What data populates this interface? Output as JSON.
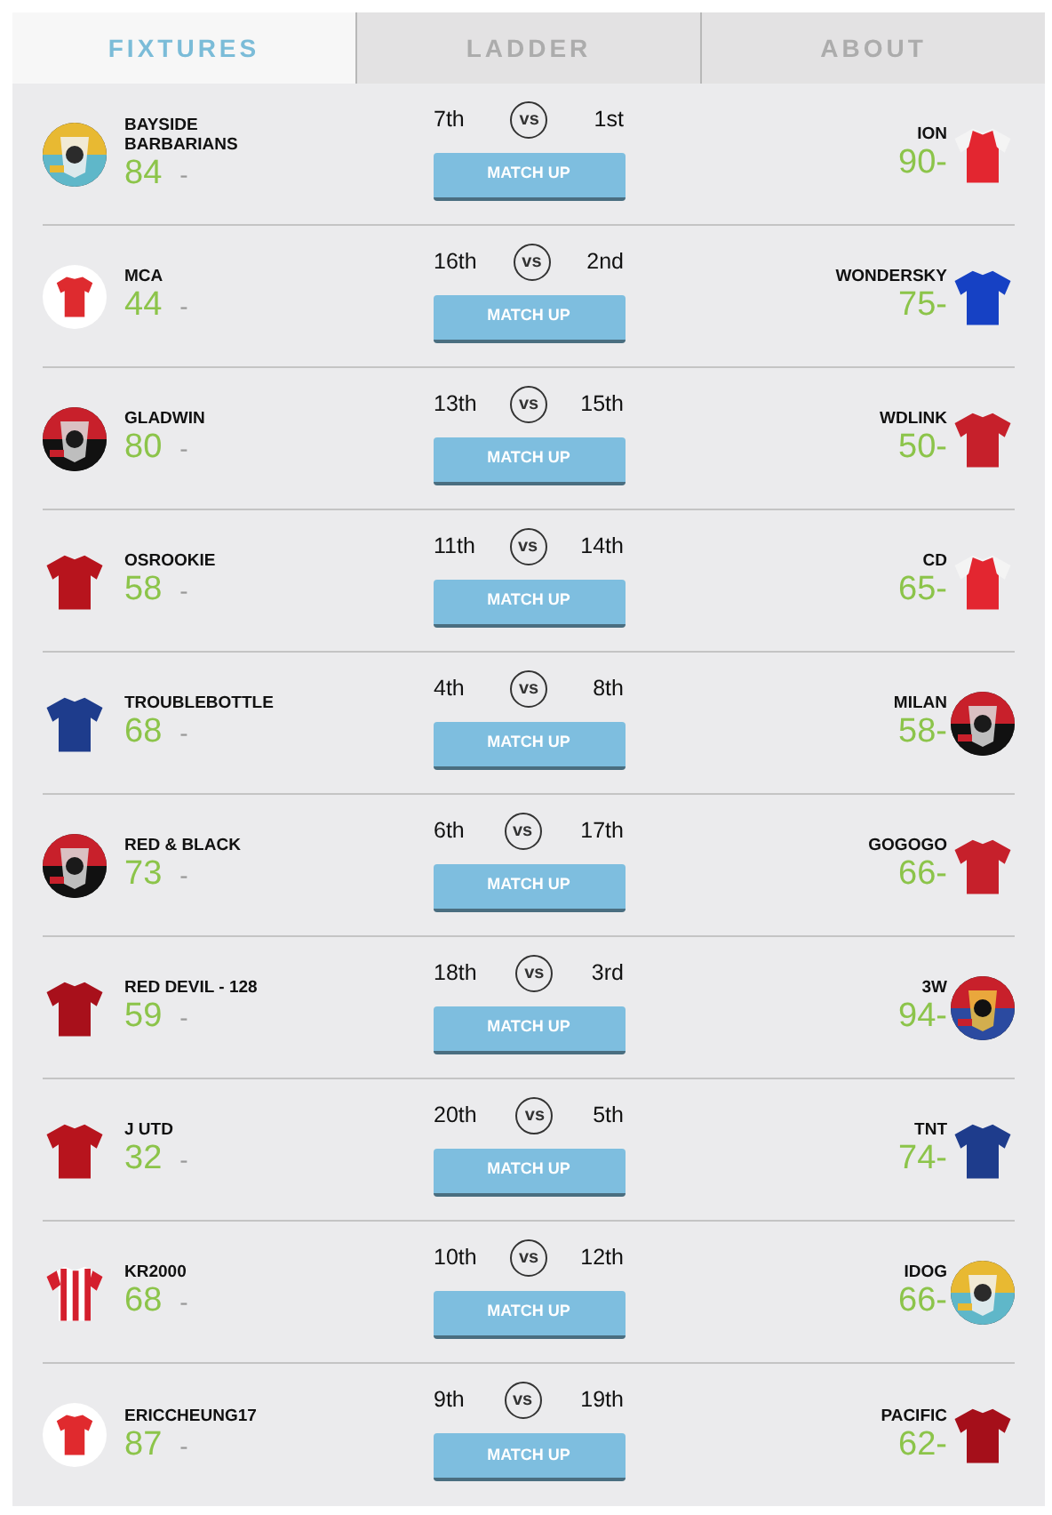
{
  "tabs": [
    {
      "label": "FIXTURES",
      "selected": true
    },
    {
      "label": "LADDER",
      "selected": false
    },
    {
      "label": "ABOUT",
      "selected": false
    }
  ],
  "fixtures": [
    {
      "home": {
        "name": "BAYSIDE BARBARIANS",
        "score": "84",
        "dash": "-"
      },
      "home_rank": "7th",
      "vs": "vs",
      "away_rank": "1st",
      "button": "MATCH UP",
      "away": {
        "name": "ION",
        "score": "90-",
        "avatar": {
          "kind": "raglan",
          "color": "#e32630"
        }
      }
    },
    {
      "home": {
        "name": "MCA",
        "score": "44",
        "dash": "-",
        "avatar": {
          "kind": "circle-shirt",
          "color": "#de2b2f"
        }
      },
      "home_rank": "16th",
      "vs": "vs",
      "away_rank": "2nd",
      "button": "MATCH UP",
      "away": {
        "name": "WONDERSKY",
        "score": "75-",
        "avatar": {
          "kind": "shirt",
          "color": "#1641c4"
        }
      }
    },
    {
      "home": {
        "name": "GLADWIN",
        "score": "80",
        "dash": "-"
      },
      "home_rank": "13th",
      "vs": "vs",
      "away_rank": "15th",
      "button": "MATCH UP",
      "away": {
        "name": "WDLINK",
        "score": "50-",
        "avatar": {
          "kind": "shirt",
          "color": "#c6202b"
        }
      }
    },
    {
      "home": {
        "name": "OSROOKIE",
        "score": "58",
        "dash": "-",
        "avatar": {
          "kind": "shirt",
          "color": "#b7141d"
        }
      },
      "home_rank": "11th",
      "vs": "vs",
      "away_rank": "14th",
      "button": "MATCH UP",
      "away": {
        "name": "CD",
        "score": "65-",
        "avatar": {
          "kind": "raglan",
          "color": "#e32630"
        }
      }
    },
    {
      "home": {
        "name": "TROUBLEBOTTLE",
        "score": "68",
        "dash": "-",
        "avatar": {
          "kind": "shirt",
          "color": "#1e3c8c"
        }
      },
      "home_rank": "4th",
      "vs": "vs",
      "away_rank": "8th",
      "button": "MATCH UP",
      "away": {
        "name": "MILAN",
        "score": "58-"
      }
    },
    {
      "home": {
        "name": "RED & BLACK",
        "score": "73",
        "dash": "-"
      },
      "home_rank": "6th",
      "vs": "vs",
      "away_rank": "17th",
      "button": "MATCH UP",
      "away": {
        "name": "GOGOGO",
        "score": "66-",
        "avatar": {
          "kind": "shirt",
          "color": "#c6202b"
        }
      }
    },
    {
      "home": {
        "name": "RED DEVIL - 128",
        "score": "59",
        "dash": "-",
        "avatar": {
          "kind": "shirt",
          "color": "#a8101b"
        }
      },
      "home_rank": "18th",
      "vs": "vs",
      "away_rank": "3rd",
      "button": "MATCH UP",
      "away": {
        "name": "3W",
        "score": "94-"
      }
    },
    {
      "home": {
        "name": "J UTD",
        "score": "32",
        "dash": "-",
        "avatar": {
          "kind": "shirt",
          "color": "#b7141d"
        }
      },
      "home_rank": "20th",
      "vs": "vs",
      "away_rank": "5th",
      "button": "MATCH UP",
      "away": {
        "name": "TNT",
        "score": "74-",
        "avatar": {
          "kind": "shirt",
          "color": "#1e3c8c"
        }
      }
    },
    {
      "home": {
        "name": "KR2000",
        "score": "68",
        "dash": "-",
        "avatar": {
          "kind": "striped",
          "color": "#d41f2d"
        }
      },
      "home_rank": "10th",
      "vs": "vs",
      "away_rank": "12th",
      "button": "MATCH UP",
      "away": {
        "name": "IDOG",
        "score": "66-"
      }
    },
    {
      "home": {
        "name": "ERICCHEUNG17",
        "score": "87",
        "dash": "-",
        "avatar": {
          "kind": "circle-shirt",
          "color": "#e02a2e"
        }
      },
      "home_rank": "9th",
      "vs": "vs",
      "away_rank": "19th",
      "button": "MATCH UP",
      "away": {
        "name": "PACIFIC",
        "score": "62-",
        "avatar": {
          "kind": "shirt",
          "color": "#a50f1a"
        }
      }
    }
  ]
}
